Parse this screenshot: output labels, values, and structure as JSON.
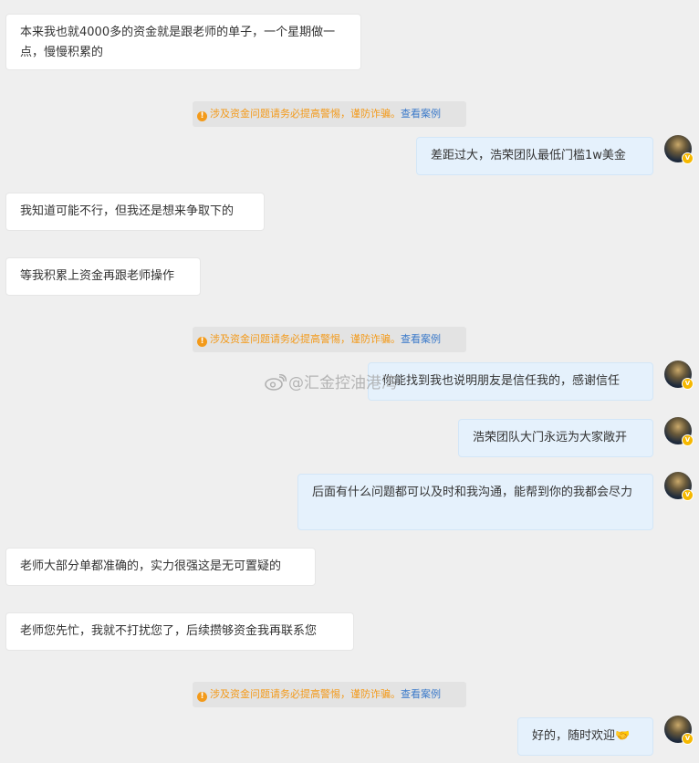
{
  "notice": {
    "text": "涉及资金问题请务必提高警惕，谨防诈骗。",
    "link": "查看案例",
    "icon": "info-warning-icon",
    "color": "#f39a1a"
  },
  "messages": [
    {
      "side": "in",
      "text": "本来我也就4000多的资金就是跟老师的单子，一个星期做一点，慢慢积累的"
    },
    {
      "side": "out",
      "text": "差距过大，浩荣团队最低门槛1w美金"
    },
    {
      "side": "in",
      "text": "我知道可能不行，但我还是想来争取下的"
    },
    {
      "side": "in",
      "text": "等我积累上资金再跟老师操作"
    },
    {
      "side": "out",
      "text": "你能找到我也说明朋友是信任我的，感谢信任"
    },
    {
      "side": "out",
      "text": "浩荣团队大门永远为大家敞开"
    },
    {
      "side": "out",
      "text": "后面有什么问题都可以及时和我沟通，能帮到你的我都会尽力"
    },
    {
      "side": "in",
      "text": "老师大部分单都准确的，实力很强这是无可置疑的"
    },
    {
      "side": "in",
      "text": "老师您先忙，我就不打扰您了，后续攒够资金我再联系您"
    },
    {
      "side": "out",
      "text": "好的，随时欢迎🤝"
    }
  ],
  "watermark": "@汇金控油港湾",
  "verified_badge": "V"
}
